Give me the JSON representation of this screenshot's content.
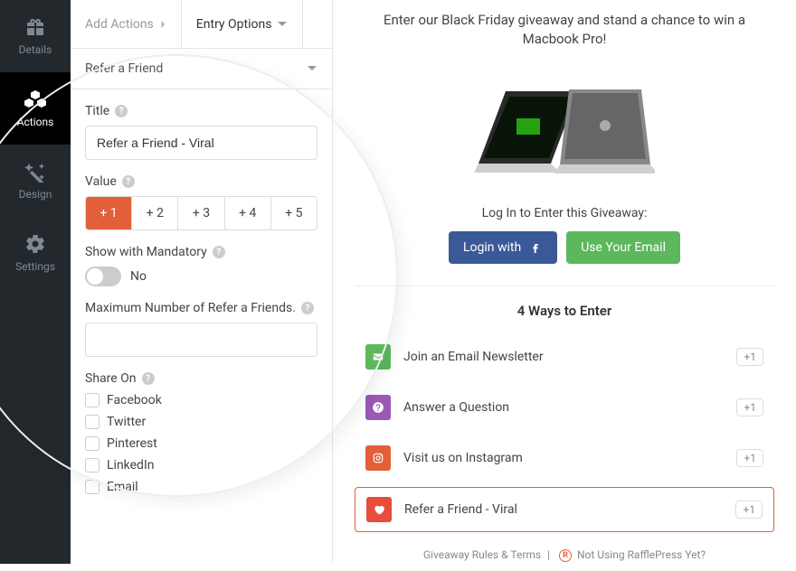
{
  "sidebar": {
    "items": [
      {
        "label": "Details",
        "active": false
      },
      {
        "label": "Actions",
        "active": true
      },
      {
        "label": "Design",
        "active": false
      },
      {
        "label": "Settings",
        "active": false
      }
    ]
  },
  "tabs": {
    "add_actions": "Add Actions",
    "entry_options": "Entry Options"
  },
  "accordion": {
    "title": "Refer a Friend"
  },
  "form": {
    "title_label": "Title",
    "title_value": "Refer a Friend - Viral",
    "value_label": "Value",
    "value_options": [
      "+ 1",
      "+ 2",
      "+ 3",
      "+ 4",
      "+ 5"
    ],
    "show_mandatory_label": "Show with Mandatory",
    "show_mandatory_value": "No",
    "max_refer_label": "Maximum Number of Refer a Friends.",
    "max_refer_value": "",
    "share_on_label": "Share On",
    "share_options": [
      "Facebook",
      "Twitter",
      "Pinterest",
      "LinkedIn",
      "Email"
    ]
  },
  "preview": {
    "headline": "Enter our Black Friday giveaway and stand a chance to win a Macbook Pro!",
    "login_text": "Log In to Enter this Giveaway:",
    "btn_login_with": "Login with",
    "btn_use_email": "Use Your Email",
    "ways_title": "4 Ways to Enter",
    "entries": [
      {
        "icon_color": "#5cb85c",
        "label": "Join an Email Newsletter",
        "badge": "+1"
      },
      {
        "icon_color": "#9b59b6",
        "label": "Answer a Question",
        "badge": "+1"
      },
      {
        "icon_color": "#e25f3a",
        "label": "Visit us on Instagram",
        "badge": "+1"
      },
      {
        "icon_color": "#e74c3c",
        "label": "Refer a Friend - Viral",
        "badge": "+1"
      }
    ],
    "footer_rules": "Giveaway Rules & Terms",
    "footer_not_using": "Not Using RafflePress Yet?"
  }
}
